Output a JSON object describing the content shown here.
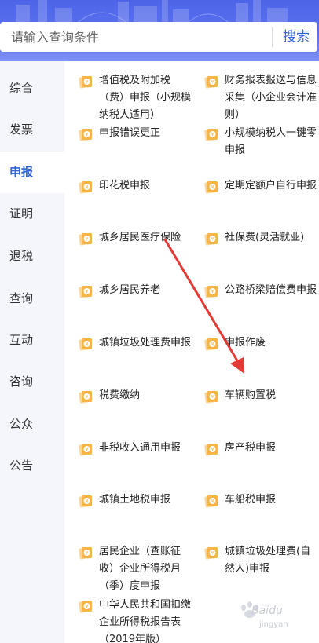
{
  "search": {
    "placeholder": "请输入查询条件",
    "button_label": "搜索"
  },
  "sidebar": {
    "items": [
      {
        "label": "综合",
        "active": false
      },
      {
        "label": "发票",
        "active": false
      },
      {
        "label": "申报",
        "active": true
      },
      {
        "label": "证明",
        "active": false
      },
      {
        "label": "退税",
        "active": false
      },
      {
        "label": "查询",
        "active": false
      },
      {
        "label": "互动",
        "active": false
      },
      {
        "label": "咨询",
        "active": false
      },
      {
        "label": "公众",
        "active": false
      },
      {
        "label": "公告",
        "active": false
      }
    ]
  },
  "services": [
    {
      "label": "增值税及附加税（费）申报（小规模纳税人适用）"
    },
    {
      "label": "财务报表报送与信息采集（小企业会计准则）"
    },
    {
      "label": "申报错误更正"
    },
    {
      "label": "小规模纳税人一键零申报"
    },
    {
      "label": "印花税申报"
    },
    {
      "label": "定期定额户自行申报"
    },
    {
      "label": "城乡居民医疗保险"
    },
    {
      "label": "社保费(灵活就业)"
    },
    {
      "label": "城乡居民养老"
    },
    {
      "label": "公路桥梁赔偿费申报"
    },
    {
      "label": "城镇垃圾处理费申报"
    },
    {
      "label": "申报作废"
    },
    {
      "label": "税费缴纳"
    },
    {
      "label": "车辆购置税"
    },
    {
      "label": "非税收入通用申报"
    },
    {
      "label": "房产税申报"
    },
    {
      "label": "城镇土地税申报"
    },
    {
      "label": "车船税申报"
    },
    {
      "label": "居民企业（查账征收）企业所得税月（季）度申报"
    },
    {
      "label": "城镇垃圾处理费(自然人)申报"
    },
    {
      "label": "中华人民共和国扣缴企业所得税报告表（2019年版）"
    }
  ],
  "service_icon": "document-coin-icon",
  "colors": {
    "accent": "#2f64d8",
    "banner": "#5a73ef",
    "annotation": "#e53935",
    "icon": "#f5b547"
  },
  "watermark": {
    "text": "Baidu",
    "sub": "jingyan"
  }
}
